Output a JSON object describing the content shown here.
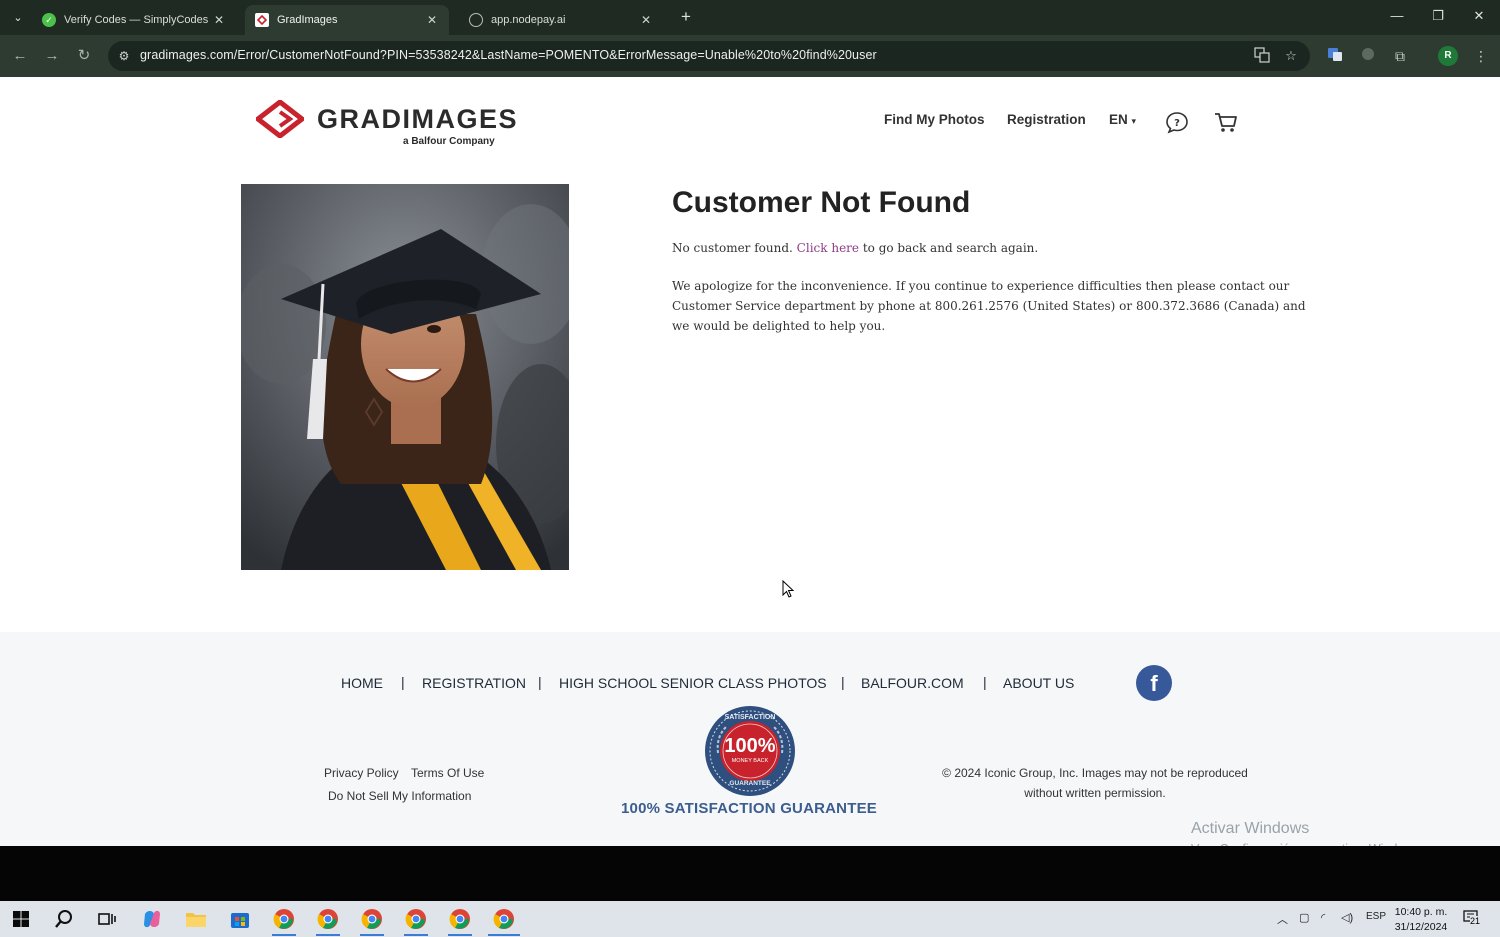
{
  "browser": {
    "tabs": [
      {
        "title": "Verify Codes — SimplyCodes",
        "active": false
      },
      {
        "title": "GradImages",
        "active": true
      },
      {
        "title": "app.nodepay.ai",
        "active": false
      }
    ],
    "new_tab": "+",
    "url": "gradimages.com/Error/CustomerNotFound?PIN=53538242&LastName=POMENTO&ErrorMessage=Unable%20to%20find%20user",
    "profile_initial": "R"
  },
  "header": {
    "logo_text": "GRADIMAGES",
    "logo_sub": "a Balfour Company",
    "nav": {
      "find_photos": "Find My Photos",
      "registration": "Registration",
      "language": "EN"
    }
  },
  "main": {
    "title": "Customer Not Found",
    "line1_before": "No customer found. ",
    "line1_link": "Click here",
    "line1_after": " to go back and search again.",
    "para_line1": "We apologize for the inconvenience. If you continue to experience difficulties then please contact our",
    "para_line2": "Customer Service department by phone at 800.261.2576 (United States) or 800.372.3686 (Canada) and",
    "para_line3": "we would be delighted to help you."
  },
  "footer": {
    "nav": [
      "HOME",
      "REGISTRATION",
      "HIGH SCHOOL SENIOR CLASS PHOTOS",
      "BALFOUR.COM",
      "ABOUT US"
    ],
    "separator": "|",
    "facebook": "f",
    "privacy": "Privacy Policy",
    "terms": "Terms Of Use",
    "do_not_sell": "Do Not Sell My Information",
    "seal": {
      "top": "SATISFACTION",
      "big": "100%",
      "mid": "MONEY BACK",
      "bottom": "GUARANTEE"
    },
    "guarantee": "100% SATISFACTION GUARANTEE",
    "copyright_line1": "© 2024 Iconic Group, Inc. Images may not be reproduced",
    "copyright_line2": "without written permission."
  },
  "watermark": {
    "line1": "Activar Windows",
    "line2": "Ve a Configuración para activar Windows."
  },
  "taskbar": {
    "language": "ESP",
    "time": "10:40 p. m.",
    "date": "31/12/2024",
    "notifications": "21"
  },
  "colors": {
    "brand_red": "#c8232c",
    "link_purple": "#8e3a86",
    "footer_bg": "#f6f7f8",
    "guarantee_blue": "#3b5d8f",
    "facebook_blue": "#385999"
  }
}
